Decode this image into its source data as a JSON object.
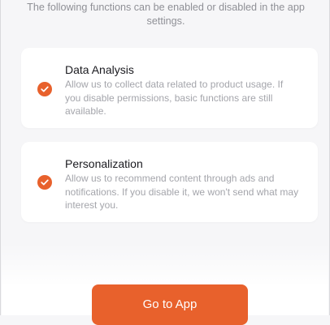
{
  "intro_text": "The following functions can be enabled or disabled in the app settings.",
  "accent_color": "#e8612c",
  "permissions": [
    {
      "title": "Data Analysis",
      "description": "Allow us to collect data related to product usage. If you disable permissions, basic functions are still available.",
      "checked": true,
      "icon": "checkmark-icon"
    },
    {
      "title": "Personalization",
      "description": "Allow us to recommend content through ads and notifications. If you disable it, we won't send what may interest you.",
      "checked": true,
      "icon": "checkmark-icon"
    }
  ],
  "primary_button": {
    "label": "Go to App"
  }
}
